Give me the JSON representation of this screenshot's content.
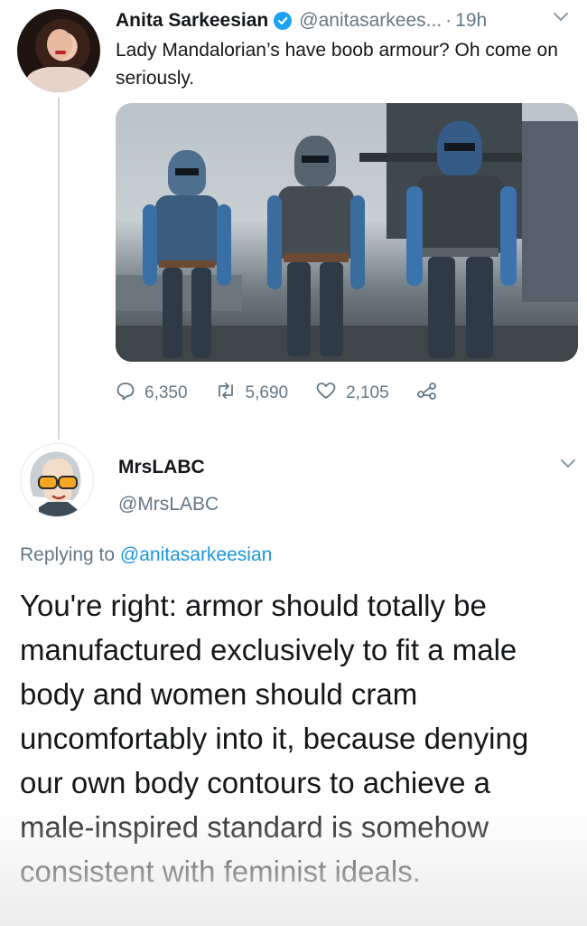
{
  "tweet": {
    "author_name": "Anita Sarkeesian",
    "handle": "@anitasarkees...",
    "separator": "·",
    "time": "19h",
    "text": "Lady Mandalorian’s have boob armour? Oh come on seriously.",
    "verified": true,
    "actions": {
      "replies": "6,350",
      "retweets": "5,690",
      "likes": "2,105"
    }
  },
  "reply": {
    "author_name": "MrsLABC",
    "handle": "@MrsLABC",
    "replying_prefix": "Replying to",
    "replying_to": "@anitasarkeesian",
    "text": "You're right: armor should totally be manufactured exclusively to fit a male body and women should cram uncomfortably into it, because denying our own body contours to achieve a male-inspired standard is somehow consistent with feminist ideals."
  },
  "icons": {
    "reply": "speech-bubble-icon",
    "retweet": "retweet-arrows-icon",
    "like": "heart-icon",
    "share": "share-nodes-icon",
    "more": "chevron-down-icon",
    "verified": "verified-check-icon"
  },
  "colors": {
    "brand_blue": "#1da1f2",
    "mention_blue": "#1b95e0",
    "muted_gray": "#657786",
    "text": "#14171a",
    "thread_line": "#ccd6dd"
  }
}
